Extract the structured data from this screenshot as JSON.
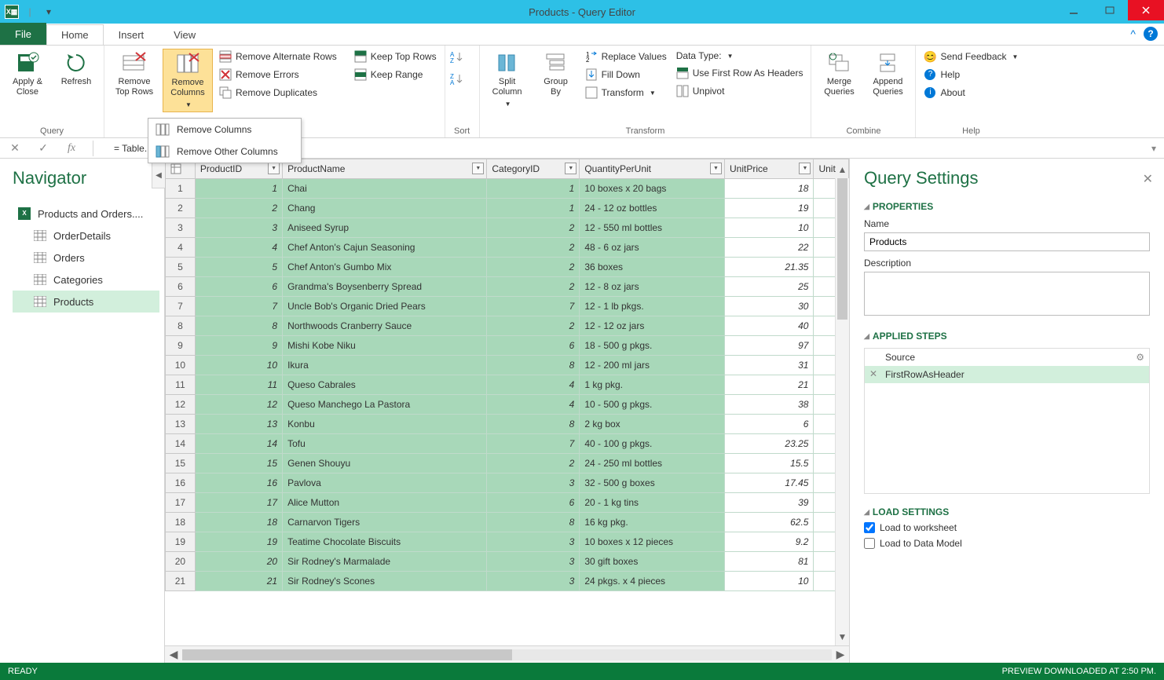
{
  "window": {
    "title": "Products - Query Editor"
  },
  "tabs": {
    "file": "File",
    "home": "Home",
    "insert": "Insert",
    "view": "View"
  },
  "ribbon": {
    "query": {
      "apply_close": "Apply &\nClose",
      "refresh": "Refresh",
      "label": "Query"
    },
    "reduce": {
      "remove_top_rows": "Remove\nTop Rows",
      "remove_columns": "Remove\nColumns",
      "remove_columns_dd1": "Remove Columns",
      "remove_columns_dd2": "Remove Other Columns",
      "remove_alternate_rows": "Remove Alternate Rows",
      "remove_errors": "Remove Errors",
      "remove_duplicates": "Remove Duplicates",
      "keep_top_rows": "Keep Top Rows",
      "keep_range": "Keep Range"
    },
    "sort": {
      "label": "Sort"
    },
    "split": {
      "split_column": "Split\nColumn",
      "group_by": "Group\nBy"
    },
    "transform": {
      "replace_values": "Replace Values",
      "fill_down": "Fill Down",
      "transform": "Transform",
      "data_type": "Data Type:",
      "first_row_headers": "Use First Row As Headers",
      "unpivot": "Unpivot",
      "label": "Transform"
    },
    "combine": {
      "merge": "Merge\nQueries",
      "append": "Append\nQueries",
      "label": "Combine"
    },
    "help": {
      "send_feedback": "Send Feedback",
      "help": "Help",
      "about": "About",
      "label": "Help"
    }
  },
  "formula_bar": {
    "text": "= Table.PromoteHeaders(Products)"
  },
  "navigator": {
    "title": "Navigator",
    "root": "Products and Orders....",
    "items": [
      "OrderDetails",
      "Orders",
      "Categories",
      "Products"
    ]
  },
  "table": {
    "headers": [
      "ProductID",
      "ProductName",
      "CategoryID",
      "QuantityPerUnit",
      "UnitPrice",
      "Unit"
    ],
    "rows": [
      {
        "n": 1,
        "pid": 1,
        "name": "Chai",
        "cat": 1,
        "qpu": "10 boxes x 20 bags",
        "price": "18"
      },
      {
        "n": 2,
        "pid": 2,
        "name": "Chang",
        "cat": 1,
        "qpu": "24 - 12 oz bottles",
        "price": "19"
      },
      {
        "n": 3,
        "pid": 3,
        "name": "Aniseed Syrup",
        "cat": 2,
        "qpu": "12 - 550 ml bottles",
        "price": "10"
      },
      {
        "n": 4,
        "pid": 4,
        "name": "Chef Anton's Cajun Seasoning",
        "cat": 2,
        "qpu": "48 - 6 oz jars",
        "price": "22"
      },
      {
        "n": 5,
        "pid": 5,
        "name": "Chef Anton's Gumbo Mix",
        "cat": 2,
        "qpu": "36 boxes",
        "price": "21.35"
      },
      {
        "n": 6,
        "pid": 6,
        "name": "Grandma's Boysenberry Spread",
        "cat": 2,
        "qpu": "12 - 8 oz jars",
        "price": "25"
      },
      {
        "n": 7,
        "pid": 7,
        "name": "Uncle Bob's Organic Dried Pears",
        "cat": 7,
        "qpu": "12 - 1 lb pkgs.",
        "price": "30"
      },
      {
        "n": 8,
        "pid": 8,
        "name": "Northwoods Cranberry Sauce",
        "cat": 2,
        "qpu": "12 - 12 oz jars",
        "price": "40"
      },
      {
        "n": 9,
        "pid": 9,
        "name": "Mishi Kobe Niku",
        "cat": 6,
        "qpu": "18 - 500 g pkgs.",
        "price": "97"
      },
      {
        "n": 10,
        "pid": 10,
        "name": "Ikura",
        "cat": 8,
        "qpu": "12 - 200 ml jars",
        "price": "31"
      },
      {
        "n": 11,
        "pid": 11,
        "name": "Queso Cabrales",
        "cat": 4,
        "qpu": "1 kg pkg.",
        "price": "21"
      },
      {
        "n": 12,
        "pid": 12,
        "name": "Queso Manchego La Pastora",
        "cat": 4,
        "qpu": "10 - 500 g pkgs.",
        "price": "38"
      },
      {
        "n": 13,
        "pid": 13,
        "name": "Konbu",
        "cat": 8,
        "qpu": "2 kg box",
        "price": "6"
      },
      {
        "n": 14,
        "pid": 14,
        "name": "Tofu",
        "cat": 7,
        "qpu": "40 - 100 g pkgs.",
        "price": "23.25"
      },
      {
        "n": 15,
        "pid": 15,
        "name": "Genen Shouyu",
        "cat": 2,
        "qpu": "24 - 250 ml bottles",
        "price": "15.5"
      },
      {
        "n": 16,
        "pid": 16,
        "name": "Pavlova",
        "cat": 3,
        "qpu": "32 - 500 g boxes",
        "price": "17.45"
      },
      {
        "n": 17,
        "pid": 17,
        "name": "Alice Mutton",
        "cat": 6,
        "qpu": "20 - 1 kg tins",
        "price": "39"
      },
      {
        "n": 18,
        "pid": 18,
        "name": "Carnarvon Tigers",
        "cat": 8,
        "qpu": "16 kg pkg.",
        "price": "62.5"
      },
      {
        "n": 19,
        "pid": 19,
        "name": "Teatime Chocolate Biscuits",
        "cat": 3,
        "qpu": "10 boxes x 12 pieces",
        "price": "9.2"
      },
      {
        "n": 20,
        "pid": 20,
        "name": "Sir Rodney's Marmalade",
        "cat": 3,
        "qpu": "30 gift boxes",
        "price": "81"
      },
      {
        "n": 21,
        "pid": 21,
        "name": "Sir Rodney's Scones",
        "cat": 3,
        "qpu": "24 pkgs. x 4 pieces",
        "price": "10"
      }
    ]
  },
  "settings": {
    "title": "Query Settings",
    "properties_h": "PROPERTIES",
    "name_label": "Name",
    "name_value": "Products",
    "desc_label": "Description",
    "applied_steps_h": "APPLIED STEPS",
    "steps": [
      "Source",
      "FirstRowAsHeader"
    ],
    "load_h": "LOAD SETTINGS",
    "load_ws": "Load to worksheet",
    "load_dm": "Load to Data Model"
  },
  "status": {
    "ready": "READY",
    "preview": "PREVIEW DOWNLOADED AT 2:50 PM."
  }
}
